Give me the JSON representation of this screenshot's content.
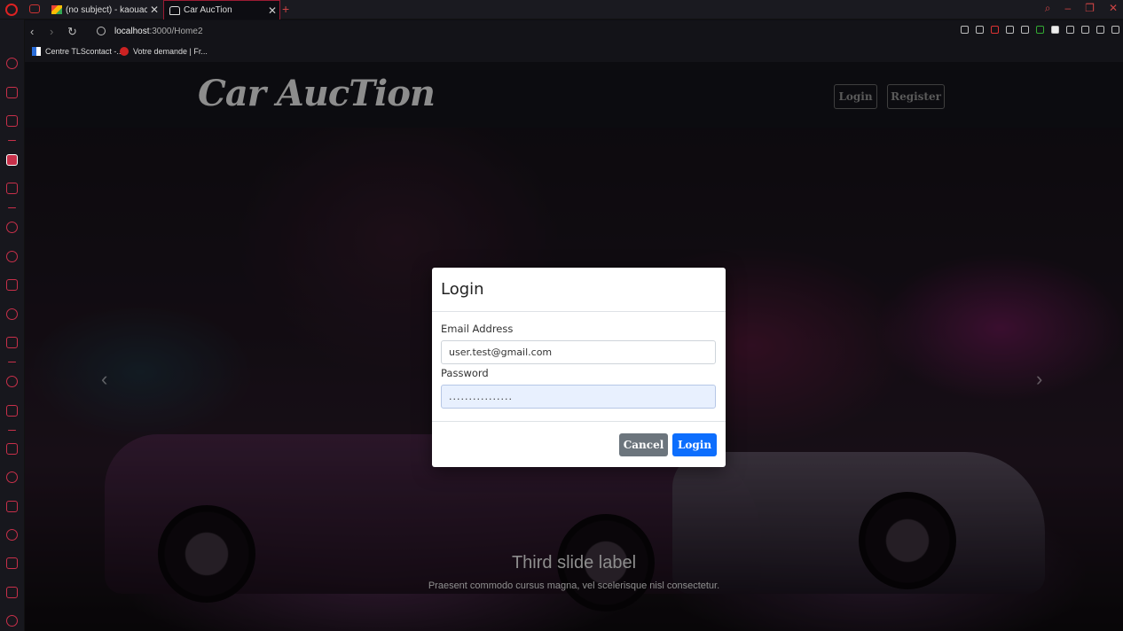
{
  "browser": {
    "tabs": [
      {
        "label": "(no subject) - kaouachime",
        "active": false
      },
      {
        "label": "Car AucTion",
        "active": true
      }
    ],
    "new_tab": "+",
    "url_host": "localhost",
    "url_rest": ":3000/Home2",
    "bookmarks": [
      {
        "label": "Centre TLScontact -..."
      },
      {
        "label": "Votre demande | Fr..."
      }
    ],
    "accent_color": "#c8304a"
  },
  "site": {
    "brand": "Car AucTion",
    "nav": {
      "login": "Login",
      "register": "Register"
    }
  },
  "carousel": {
    "prev": "‹",
    "next": "›",
    "caption_title": "Third slide label",
    "caption_text": "Praesent commodo cursus magna, vel scelerisque nisl consectetur."
  },
  "modal": {
    "title": "Login",
    "email_label": "Email Address",
    "email_value": "user.test@gmail.com",
    "password_label": "Password",
    "password_value": "................",
    "cancel": "Cancel",
    "login": "Login",
    "primary_color": "#0d6efd",
    "secondary_color": "#6c757d"
  }
}
